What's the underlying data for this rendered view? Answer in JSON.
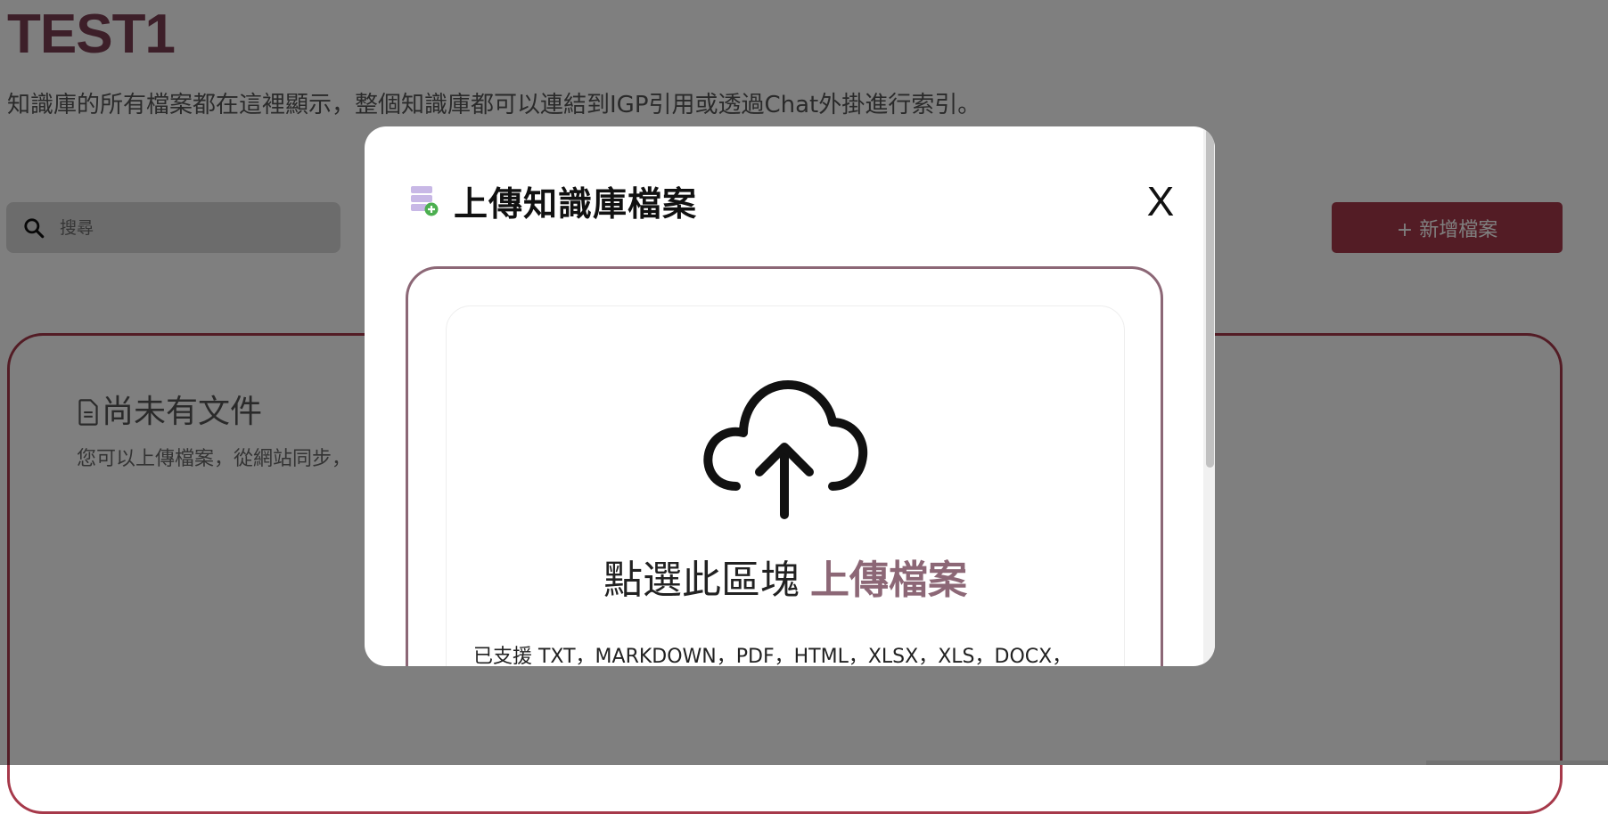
{
  "page": {
    "title": "TEST1",
    "description": "知識庫的所有檔案都在這裡顯示，整個知識庫都可以連結到IGP引用或透過Chat外掛進行索引。"
  },
  "toolbar": {
    "search_placeholder": "搜尋",
    "add_file_label": "+ 新增檔案"
  },
  "empty_state": {
    "title": "尚未有文件",
    "description": "您可以上傳檔案，從網站同步，"
  },
  "modal": {
    "title": "上傳知識庫檔案",
    "close_label": "X",
    "upload_prompt": "點選此區塊",
    "upload_prompt_accent": "上傳檔案",
    "supported_formats": "已支援 TXT，MARKDOWN，PDF，HTML，XLSX，XLS，DOCX，"
  },
  "colors": {
    "brand": "#a6394a",
    "accent": "#8c6776",
    "icon_purple": "#c8b8e6",
    "icon_green": "#4caf50"
  },
  "icons": {
    "search": "search-icon",
    "document": "document-icon",
    "database_add": "database-add-icon",
    "cloud_upload": "cloud-upload-icon"
  }
}
